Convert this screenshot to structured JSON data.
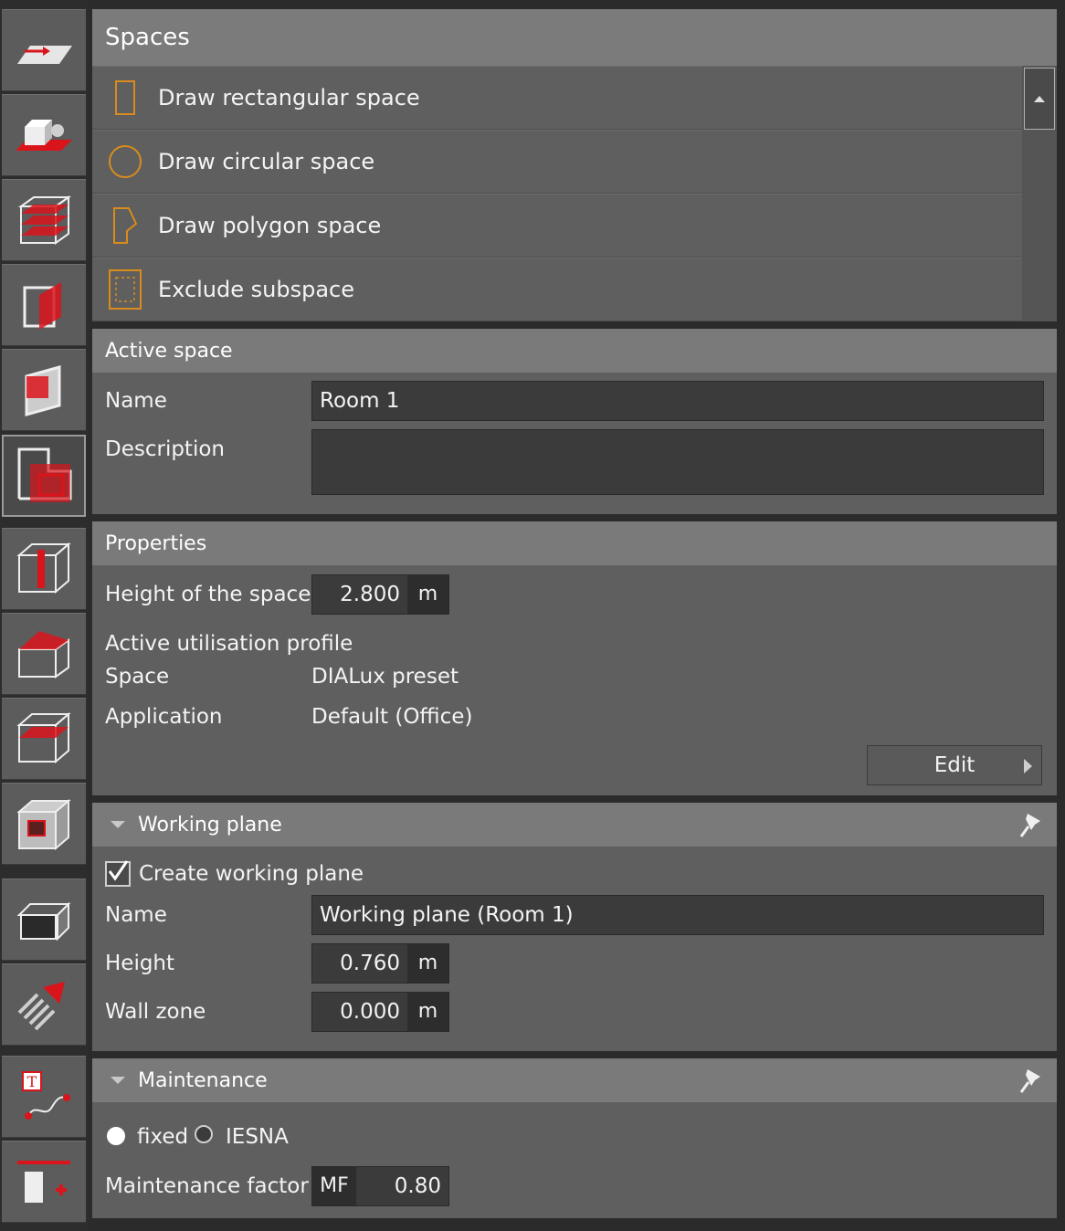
{
  "spaces": {
    "title": "Spaces",
    "items": [
      {
        "label": "Draw rectangular space",
        "icon": "rectangle-space-icon"
      },
      {
        "label": "Draw circular space",
        "icon": "circle-space-icon"
      },
      {
        "label": "Draw polygon space",
        "icon": "polygon-space-icon"
      },
      {
        "label": "Exclude subspace",
        "icon": "exclude-subspace-icon"
      }
    ]
  },
  "active_space": {
    "title": "Active space",
    "name_label": "Name",
    "name_value": "Room 1",
    "description_label": "Description",
    "description_value": ""
  },
  "properties": {
    "title": "Properties",
    "height_label": "Height of the space",
    "height_value": "2.800",
    "height_unit": "m",
    "profile_label": "Active utilisation profile",
    "space_label": "Space",
    "space_value": "DIALux preset",
    "application_label": "Application",
    "application_value": "Default (Office)",
    "edit_label": "Edit"
  },
  "working_plane": {
    "title": "Working plane",
    "create_label": "Create working plane",
    "create_checked": true,
    "name_label": "Name",
    "name_value": "Working plane (Room 1)",
    "height_label": "Height",
    "height_value": "0.760",
    "height_unit": "m",
    "wall_zone_label": "Wall zone",
    "wall_zone_value": "0.000",
    "wall_zone_unit": "m"
  },
  "maintenance": {
    "title": "Maintenance",
    "fixed_label": "fixed",
    "iesna_label": "IESNA",
    "selected": "fixed",
    "factor_label": "Maintenance factor",
    "factor_prefix": "MF",
    "factor_value": "0.80"
  },
  "colors": {
    "accent_red": "#d9141b",
    "icon_orange": "#d98b1c"
  }
}
